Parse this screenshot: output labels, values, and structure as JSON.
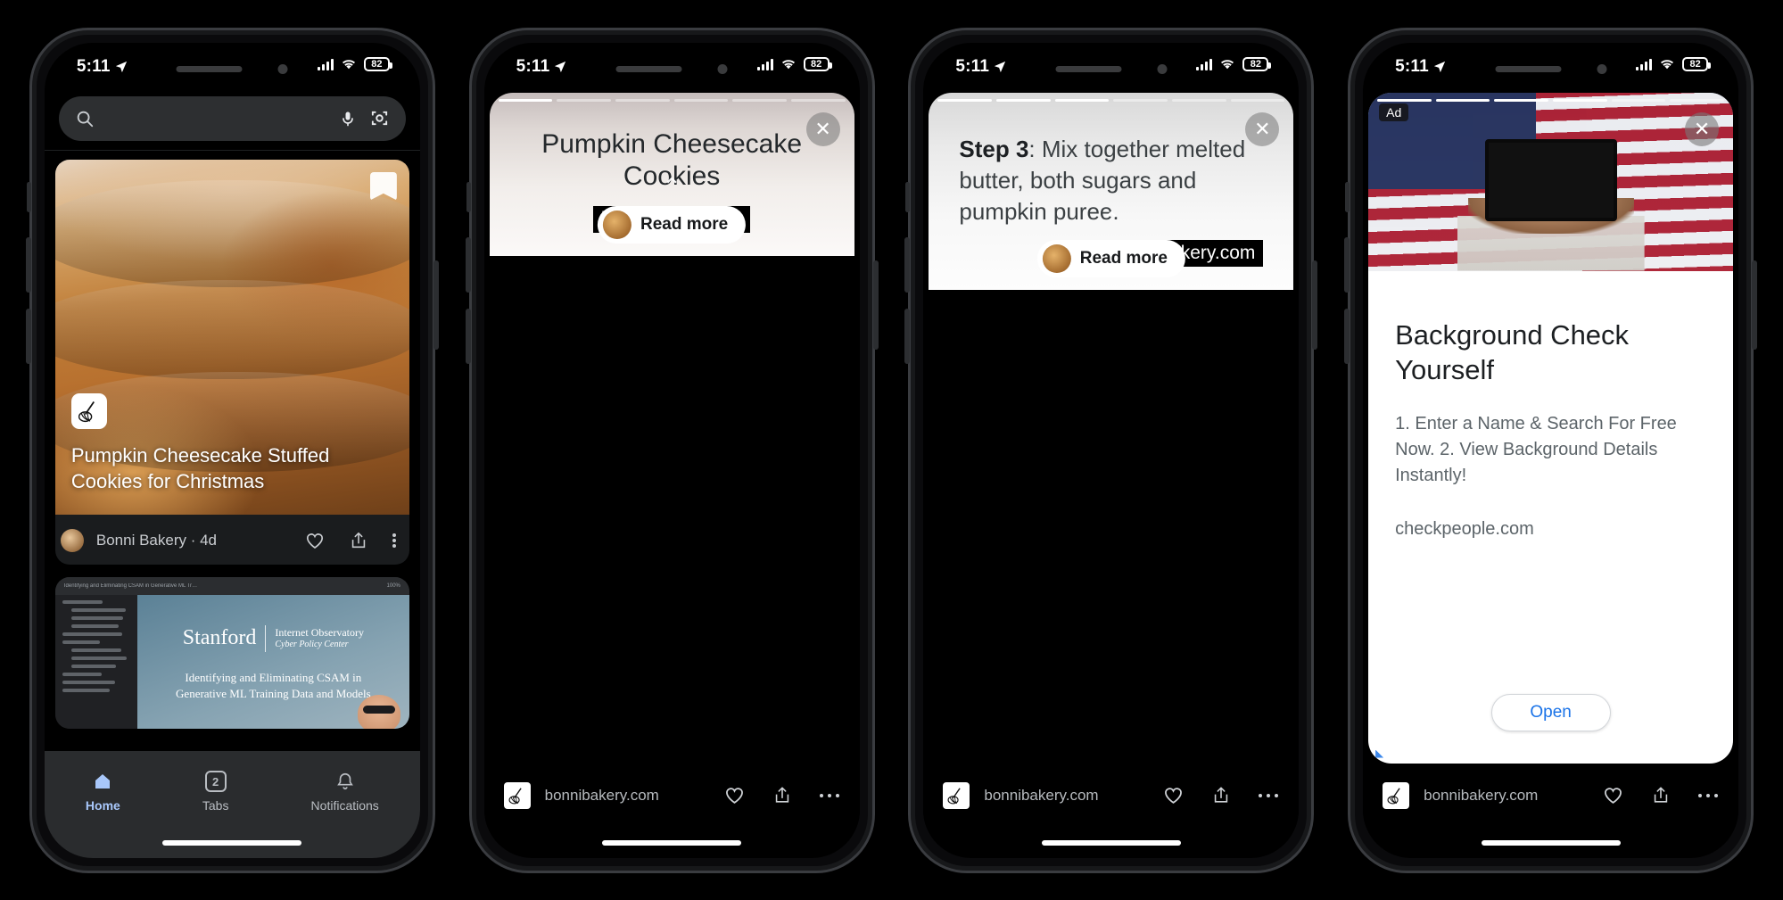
{
  "status_bar": {
    "time": "5:11",
    "battery": "82",
    "location_icon": "location-arrow-icon"
  },
  "phone1": {
    "search": {
      "placeholder": "",
      "value": "",
      "search_icon": "search-icon",
      "mic_icon": "microphone-icon",
      "lens_icon": "camera-lens-icon"
    },
    "card1": {
      "title": "Pumpkin Cheesecake Stuffed Cookies for Christmas",
      "source": "Bonni Bakery · 4d",
      "bookmark_icon": "bookmark-icon",
      "favicon": "whisk-icon",
      "like_icon": "heart-icon",
      "share_icon": "share-icon",
      "more_icon": "more-vertical-icon"
    },
    "card2": {
      "org": "Stanford",
      "org_sub": "Internet Observatory",
      "org_sub2": "Cyber Policy Center",
      "headline": "Identifying and Eliminating CSAM in",
      "headline2": "Generative ML Training Data and Models",
      "doc_tab_title": "Identifying and Eliminating CSAM in Generative ML Training Data and Models",
      "zoom": "100%"
    },
    "nav": [
      {
        "label": "Home",
        "icon": "home-icon",
        "active": true
      },
      {
        "label": "Tabs",
        "icon": "tabs-icon",
        "badge": "2",
        "active": false
      },
      {
        "label": "Notifications",
        "icon": "bell-icon",
        "active": false
      }
    ]
  },
  "phone2": {
    "title": "Pumpkin Cheesecake Cookies",
    "attribution": "bonnibakery.com",
    "close_icon": "close-icon",
    "chevron_icon": "chevron-up-icon",
    "read_more": "Read more",
    "bottom": {
      "domain": "bonnibakery.com",
      "favicon": "whisk-icon",
      "like_icon": "heart-icon",
      "share_icon": "share-icon",
      "more_icon": "more-horizontal-icon"
    },
    "segments": {
      "total": 6,
      "active": 1
    }
  },
  "phone3": {
    "step_label": "Step 3",
    "step_text": ": Mix together melted butter, both sugars and pumpkin puree.",
    "attribution": "bonnibakery.com",
    "close_icon": "close-icon",
    "chevron_icon": "chevron-up-icon",
    "read_more": "Read more",
    "bottom": {
      "domain": "bonnibakery.com",
      "favicon": "whisk-icon",
      "like_icon": "heart-icon",
      "share_icon": "share-icon",
      "more_icon": "more-horizontal-icon"
    },
    "segments": {
      "total": 6,
      "active": 3
    }
  },
  "phone4": {
    "ad_label": "Ad",
    "close_icon": "close-icon",
    "title": "Background Check Yourself",
    "description": "1. Enter a Name & Search For Free Now. 2. View Background Details Instantly!",
    "url": "checkpeople.com",
    "open_label": "Open",
    "bottom": {
      "domain": "bonnibakery.com",
      "favicon": "whisk-icon",
      "like_icon": "heart-icon",
      "share_icon": "share-icon",
      "more_icon": "more-horizontal-icon"
    },
    "segments": {
      "total": 6,
      "active": 4
    }
  },
  "colors": {
    "accent_blue": "#1a73e8",
    "nav_active": "#a8c7fa",
    "dark_bg": "#000000",
    "card_bg": "#1a1c1e"
  }
}
